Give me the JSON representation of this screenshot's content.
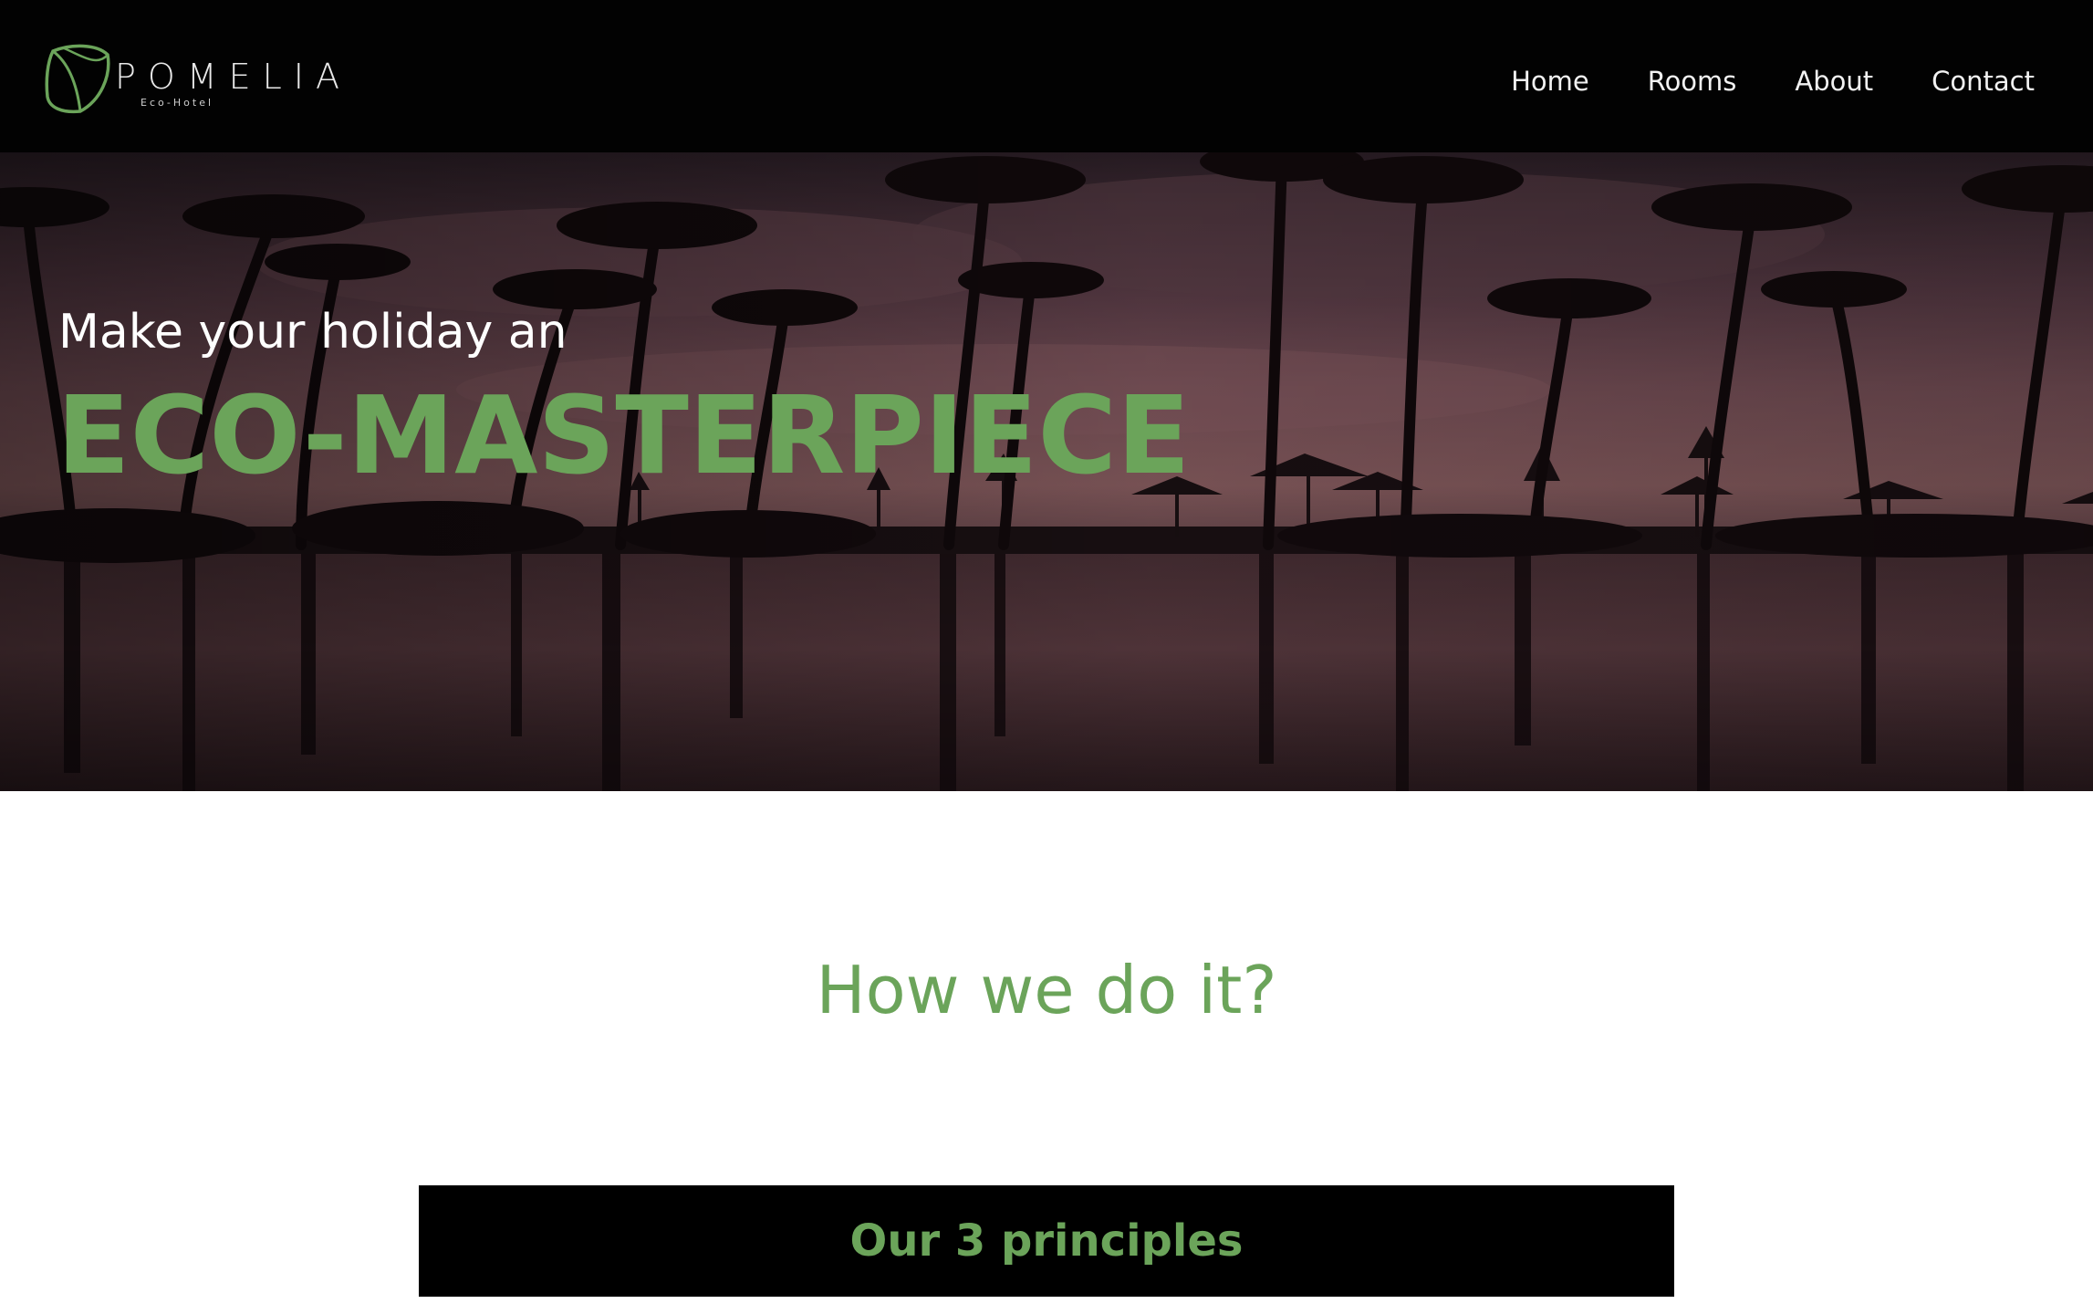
{
  "header": {
    "logo": {
      "initial": "P",
      "word": "POMELIA",
      "tagline": "Eco-Hotel"
    },
    "nav": [
      {
        "label": "Home"
      },
      {
        "label": "Rooms"
      },
      {
        "label": "About"
      },
      {
        "label": "Contact"
      }
    ]
  },
  "hero": {
    "subtitle": "Make your holiday an",
    "title": "ECO-MASTERPIECE"
  },
  "section": {
    "title": "How we do it?",
    "principles_label": "Our 3 principles"
  },
  "colors": {
    "accent_green": "#6ba45a",
    "header_bg": "#020202",
    "hero_tint": "#5f3f47"
  },
  "icons": {
    "logo_mark": "leaf-icon"
  }
}
